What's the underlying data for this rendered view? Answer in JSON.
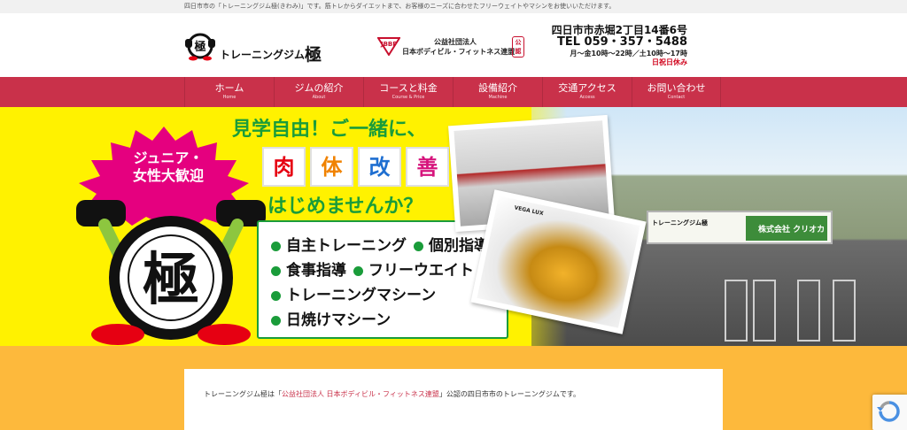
{
  "topline": {
    "text": "四日市市の「トレーニングジム極(きわみ)」です。筋トレからダイエットまで、お客様のニーズに合わせたフリーウェイトやマシンをお使いいただけます。"
  },
  "header": {
    "logo_prefix": "トレーニングジム",
    "logo_kanji": "極",
    "jbbf_line1": "公益社団法人",
    "jbbf_line2": "日本ボディビル・フィットネス連盟",
    "jbbf_seal": "公認",
    "address": "四日市市赤堀2丁目14番6号",
    "tel": "TEL 059・357・5488",
    "hours": "月～金10時～22時／土10時～17時",
    "closed": "日祝日休み"
  },
  "nav": [
    {
      "jp": "ホーム",
      "en": "Home"
    },
    {
      "jp": "ジムの紹介",
      "en": "About"
    },
    {
      "jp": "コースと料金",
      "en": "Course & Price"
    },
    {
      "jp": "設備紹介",
      "en": "Machine"
    },
    {
      "jp": "交通アクセス",
      "en": "Access"
    },
    {
      "jp": "お問い合わせ",
      "en": "Contact"
    }
  ],
  "hero": {
    "star_line1": "ジュニア・",
    "star_line2": "女性大歓迎",
    "headline1": "見学自由！ご一緒に、",
    "kanji": [
      "肉",
      "体",
      "改",
      "善"
    ],
    "kanji_colors": [
      "#e60012",
      "#f08200",
      "#1f6fd1",
      "#d6147c"
    ],
    "headline2": "はじめませんか？",
    "features": [
      [
        "自主トレーニング",
        "個別指導"
      ],
      [
        "食事指導",
        "フリーウエイト"
      ],
      [
        "トレーニングマシーン"
      ],
      [
        "日焼けマシーン"
      ]
    ],
    "photo2_caption": "VEGA LUX",
    "sign_left": "トレーニングジム極",
    "sign_right": "株式会社 クリオカ",
    "accent_green": "#1a9c3a",
    "accent_yellow": "#fff200"
  },
  "main": {
    "intro_before": "トレーニングジム極は「",
    "intro_link": "公益社団法人 日本ボディビル・フィットネス連盟",
    "intro_after": "」公認の四日市市のトレーニングジムです。"
  }
}
